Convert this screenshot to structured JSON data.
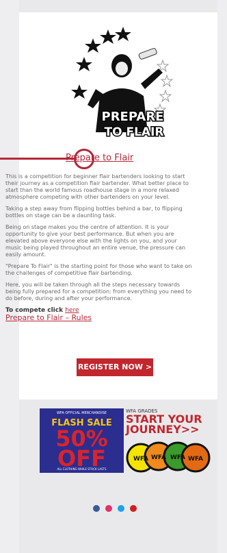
{
  "hero": {
    "logo_line1": "PREPARE",
    "logo_line2": "TO FLAIR"
  },
  "article": {
    "title": "Prepare to Flair",
    "paragraphs": [
      "This is a competition for beginner flair bartenders looking to start their journey as a competition flair bartender.  What better place to start than the world famous roadhouse stage in a more relaxed atmosphere competing with other bartenders on your level.",
      "Taking a step away from flipping bottles behind a bar, to flipping bottles on stage can be a daunting task.",
      "Being on stage makes you the centre of attention. It is your opportunity to give your best performance. But when you are elevated above everyone else with the lights on you, and your music being played throughout an entire venue, the pressure can easily amount.",
      "\"Prepare To Flair\" is the starting point for those who want to take on the challenges of competitive flair bartending.",
      "Here, you will be taken through all the steps necessary towards being fully prepared for a competition: from everything you need to do before, during and after your performance."
    ],
    "cta_prefix": "To compete click ",
    "cta_link": "here",
    "rules_link": "Prepare to Flair – Rules",
    "register_button": "REGISTER NOW >"
  },
  "banners": {
    "flash": {
      "top": "WFA OFFICIAL MERCHANDISE",
      "headline": "FLASH SALE",
      "percent": "50%",
      "off": "OFF",
      "bottom": "ALL CLOTHING WHILE STOCK LASTS"
    },
    "grades": {
      "label": "WFA GRADES",
      "headline1": "START YOUR",
      "headline2": "JOURNEY>>",
      "badge_text": "WFA"
    }
  },
  "social": {
    "icons": [
      "facebook-icon",
      "instagram-icon",
      "twitter-icon",
      "youtube-icon"
    ],
    "colors": [
      "#3b5998",
      "#e1306c",
      "#1da1f2",
      "#cd201f"
    ]
  },
  "colors": {
    "accent": "#b4283a",
    "button": "#c1272d",
    "flash_bg": "#2b2d8f"
  }
}
